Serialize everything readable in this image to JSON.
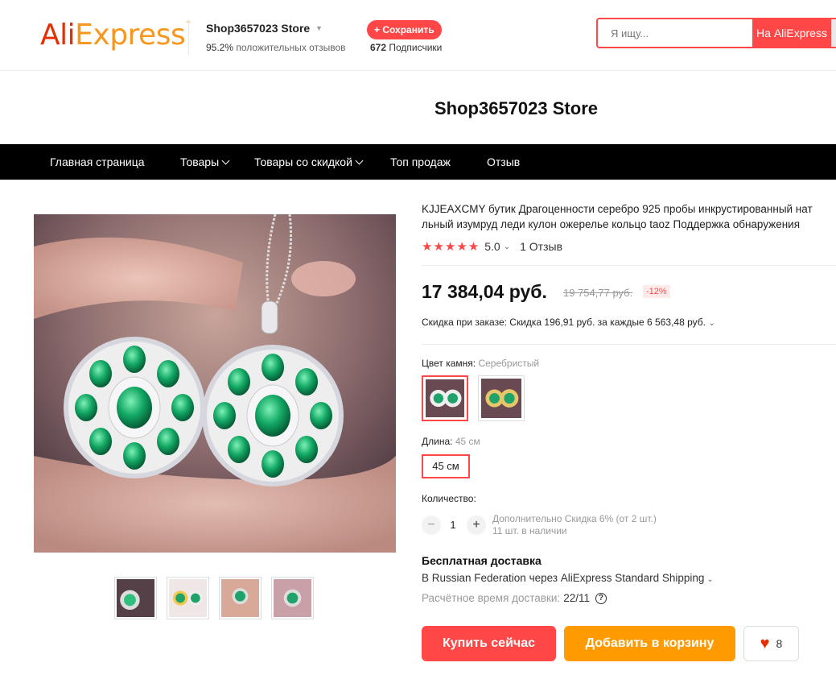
{
  "header": {
    "logo_ali": "Ali",
    "logo_express": "Express",
    "store_name": "Shop3657023 Store",
    "positive_pct": "95.2%",
    "positive_text": "положительных отзывов",
    "save_label": "+ Сохранить",
    "subscribers_count": "672",
    "subscribers_label": "Подписчики",
    "search_placeholder": "Я ищу...",
    "search_button": "На AliExpress"
  },
  "banner": {
    "title": "Shop3657023 Store"
  },
  "nav": {
    "items": [
      {
        "label": "Главная страница",
        "has_dropdown": false
      },
      {
        "label": "Товары",
        "has_dropdown": true
      },
      {
        "label": "Товары со скидкой",
        "has_dropdown": true
      },
      {
        "label": "Топ продаж",
        "has_dropdown": false
      },
      {
        "label": "Отзыв",
        "has_dropdown": false
      }
    ]
  },
  "product": {
    "title_line1": "KJJEAXCMY бутик Драгоценности серебро 925 пробы инкрустированный нат",
    "title_line2": "льный изумруд леди кулон ожерелье кольцо taoz Поддержка обнаружения",
    "rating": "5.0",
    "stars": "★★★★★",
    "reviews": "1 Отзыв",
    "price": "17 384,04 руб.",
    "old_price": "19 754,77 руб.",
    "discount": "-12%",
    "coupon": "Скидка при заказе: Скидка 196,91 руб. за каждые 6 563,48 руб.",
    "color_label": "Цвет камня:",
    "color_value": "Серебристый",
    "length_label": "Длина:",
    "length_value": "45 см",
    "length_option": "45 см",
    "qty_label": "Количество:",
    "qty_value": "1",
    "qty_minus": "−",
    "qty_plus": "+",
    "qty_note1": "Дополнительно Скидка 6% (от 2 шт.)",
    "qty_note2": "11 шт. в наличии",
    "shipping_title": "Бесплатная доставка",
    "shipping_line": "В Russian Federation через AliExpress Standard Shipping",
    "delivery_label": "Расчётное время доставки:",
    "delivery_value": "22/11",
    "delivery_help": "?",
    "buy_label": "Купить сейчас",
    "cart_label": "Добавить в корзину",
    "wish_count": "8"
  },
  "colors": {
    "accent": "#ff4747",
    "cart": "#ff9a00",
    "nav_bg": "#000000",
    "emerald": "#1fa36a"
  }
}
